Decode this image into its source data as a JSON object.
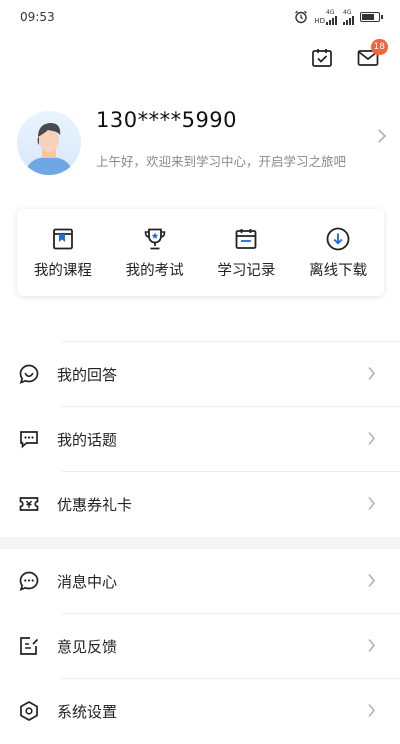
{
  "status_bar": {
    "time": "09:53",
    "network1": "4G",
    "network2": "4G",
    "hd": "HD",
    "battery_percent": 78
  },
  "header": {
    "notification_count": "18"
  },
  "profile": {
    "phone": "130****5990",
    "greeting": "上午好，欢迎来到学习中心，开启学习之旅吧"
  },
  "shortcuts": [
    {
      "label": "我的课程",
      "icon": "book-icon"
    },
    {
      "label": "我的考试",
      "icon": "trophy-icon"
    },
    {
      "label": "学习记录",
      "icon": "calendar-list-icon"
    },
    {
      "label": "离线下载",
      "icon": "download-icon"
    }
  ],
  "menu_group1": [
    {
      "label": "我的回答",
      "icon": "chat-bubble-icon"
    },
    {
      "label": "我的话题",
      "icon": "topic-chat-icon"
    },
    {
      "label": "优惠券礼卡",
      "icon": "coupon-icon"
    }
  ],
  "menu_group2": [
    {
      "label": "消息中心",
      "icon": "message-icon"
    },
    {
      "label": "意见反馈",
      "icon": "feedback-edit-icon"
    },
    {
      "label": "系统设置",
      "icon": "settings-icon"
    }
  ],
  "colors": {
    "accent": "#1e6fd9",
    "badge": "#f1643d",
    "text": "#222222",
    "muted": "#888888"
  }
}
